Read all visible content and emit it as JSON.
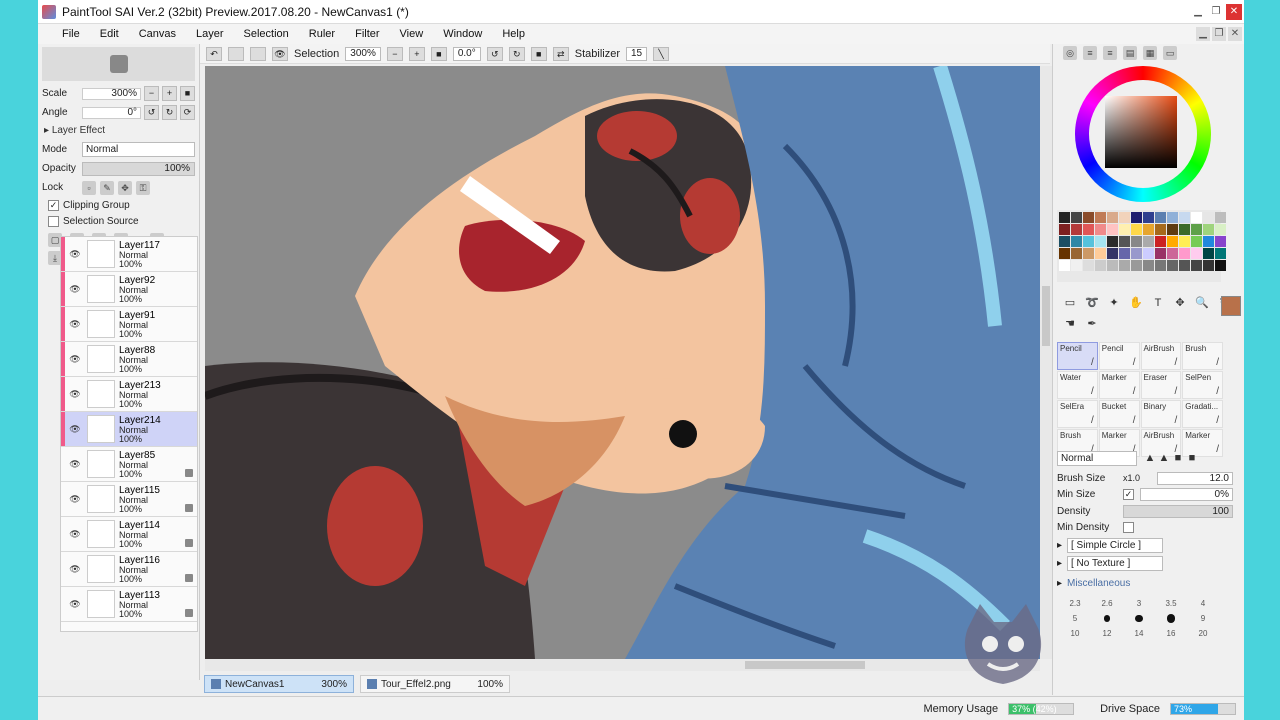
{
  "window": {
    "title": "PaintTool SAI Ver.2 (32bit) Preview.2017.08.20 - NewCanvas1 (*)"
  },
  "menu": [
    "File",
    "Edit",
    "Canvas",
    "Layer",
    "Selection",
    "Ruler",
    "Filter",
    "View",
    "Window",
    "Help"
  ],
  "navigator": {
    "scale_label": "Scale",
    "scale_value": "300%",
    "angle_label": "Angle",
    "angle_value": "0°"
  },
  "layer_panel": {
    "effect_header": "Layer Effect",
    "mode_label": "Mode",
    "mode_value": "Normal",
    "opacity_label": "Opacity",
    "opacity_value": "100%",
    "lock_label": "Lock",
    "clipping_group_label": "Clipping Group",
    "selection_source_label": "Selection Source",
    "layers": [
      {
        "name": "Layer117",
        "mode": "Normal",
        "opacity": "100%",
        "clipped": true
      },
      {
        "name": "Layer92",
        "mode": "Normal",
        "opacity": "100%",
        "clipped": true
      },
      {
        "name": "Layer91",
        "mode": "Normal",
        "opacity": "100%",
        "clipped": true
      },
      {
        "name": "Layer88",
        "mode": "Normal",
        "opacity": "100%",
        "clipped": true
      },
      {
        "name": "Layer213",
        "mode": "Normal",
        "opacity": "100%",
        "clipped": true
      },
      {
        "name": "Layer214",
        "mode": "Normal",
        "opacity": "100%",
        "clipped": true,
        "selected": true
      },
      {
        "name": "Layer85",
        "mode": "Normal",
        "opacity": "100%",
        "clipped": false
      },
      {
        "name": "Layer115",
        "mode": "Normal",
        "opacity": "100%",
        "clipped": false
      },
      {
        "name": "Layer114",
        "mode": "Normal",
        "opacity": "100%",
        "clipped": false
      },
      {
        "name": "Layer116",
        "mode": "Normal",
        "opacity": "100%",
        "clipped": false
      },
      {
        "name": "Layer113",
        "mode": "Normal",
        "opacity": "100%",
        "clipped": false
      }
    ]
  },
  "canvas_toolbar": {
    "selection_label": "Selection",
    "zoom_value": "300%",
    "angle_value": "0.0°",
    "stabilizer_label": "Stabilizer",
    "stabilizer_value": "15"
  },
  "tabs": [
    {
      "name": "NewCanvas1",
      "zoom": "300%",
      "active": true
    },
    {
      "name": "Tour_Effel2.png",
      "zoom": "100%",
      "active": false
    }
  ],
  "status": {
    "memory_label": "Memory Usage",
    "memory_value": "37% (42%)",
    "memory_fraction": 0.42,
    "drive_label": "Drive Space",
    "drive_value": "73%",
    "drive_fraction": 0.73
  },
  "tools_panel": {
    "brushes": [
      {
        "label": "Pencil",
        "selected": true
      },
      {
        "label": "Pencil"
      },
      {
        "label": "AirBrush"
      },
      {
        "label": "Brush"
      },
      {
        "label": "Water"
      },
      {
        "label": "Marker"
      },
      {
        "label": "Eraser"
      },
      {
        "label": "SelPen"
      },
      {
        "label": "SelEra"
      },
      {
        "label": "Bucket"
      },
      {
        "label": "Binary"
      },
      {
        "label": "Gradati..."
      },
      {
        "label": "Brush"
      },
      {
        "label": "Marker"
      },
      {
        "label": "AirBrush"
      },
      {
        "label": "Marker"
      }
    ],
    "blend_mode": "Normal",
    "brush_size_label": "Brush Size",
    "brush_size_multiplier": "x1.0",
    "brush_size_value": "12.0",
    "min_size_label": "Min Size",
    "min_size_value": "0%",
    "density_label": "Density",
    "density_value": "100",
    "min_density_label": "Min Density",
    "shape_value": "[ Simple Circle ]",
    "texture_value": "[ No Texture ]",
    "misc_label": "Miscellaneous",
    "dot_sizes": [
      "2.3",
      "2.6",
      "3",
      "3.5",
      "4",
      "5",
      "",
      "",
      "",
      "9",
      "10",
      "12",
      "14",
      "16",
      "20"
    ]
  },
  "colors": {
    "current": "#b8714a",
    "swatches": [
      "#222222",
      "#444444",
      "#8a4b2a",
      "#c07a55",
      "#d9a98a",
      "#f2d3bb",
      "#1d1d6e",
      "#2e3f8f",
      "#5b7fb0",
      "#8fb0d8",
      "#c7d9ef",
      "#ffffff",
      "#e6e6e6",
      "#bdbdbd",
      "#7d2020",
      "#b43a3a",
      "#e05757",
      "#f08a8a",
      "#ffc3c3",
      "#fff0b0",
      "#ffd84a",
      "#e6a52e",
      "#a66a1b",
      "#5e3c10",
      "#3b6b2a",
      "#5fa14a",
      "#9fd47d",
      "#d9f0c6",
      "#1b4e63",
      "#2f87a6",
      "#55c2dc",
      "#a6e4f0",
      "#2b2b2b",
      "#555555",
      "#888888",
      "#aaaaaa",
      "#cc2222",
      "#ffaa00",
      "#ffee55",
      "#77cc55",
      "#2288dd",
      "#8844cc",
      "#663300",
      "#996633",
      "#cc9966",
      "#ffcc99",
      "#333366",
      "#6666aa",
      "#9999cc",
      "#ccccff",
      "#993366",
      "#cc6699",
      "#ff99cc",
      "#ffccee",
      "#004444",
      "#007777",
      "#ffffff",
      "#f0f0f0",
      "#dddddd",
      "#cccccc",
      "#bbbbbb",
      "#aaaaaa",
      "#999999",
      "#888888",
      "#777777",
      "#666666",
      "#555555",
      "#444444",
      "#333333",
      "#111111"
    ]
  }
}
